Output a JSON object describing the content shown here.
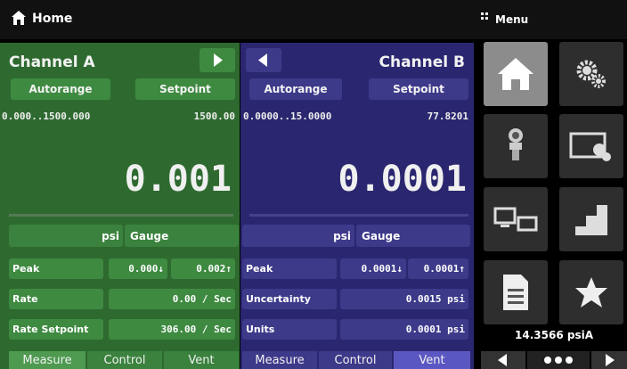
{
  "header": {
    "title": "Home",
    "menu_title": "Menu"
  },
  "colors": {
    "channel_a": "#2e6a30",
    "channel_b": "#2a2770",
    "button_a": "#3e8a41",
    "button_b": "#3d3a8a",
    "tab_active_b": "#5b57c2"
  },
  "channel_a": {
    "title": "Channel A",
    "autorange": "Autorange",
    "setpoint": "Setpoint",
    "range": "0.000..1500.000",
    "range_max": "1500.00",
    "reading": "0.001",
    "unit": "psi",
    "mode": "Gauge",
    "rows": [
      {
        "label": "Peak",
        "value_low": "0.000↓",
        "value_high": "0.002↑"
      },
      {
        "label": "Rate",
        "value": "0.00 / Sec"
      },
      {
        "label": "Rate Setpoint",
        "value": "306.00 / Sec"
      }
    ],
    "tabs": [
      "Measure",
      "Control",
      "Vent"
    ]
  },
  "channel_b": {
    "title": "Channel B",
    "autorange": "Autorange",
    "setpoint": "Setpoint",
    "range": "0.0000..15.0000",
    "range_max": "77.8201",
    "reading": "0.0001",
    "unit": "psi",
    "mode": "Gauge",
    "rows": [
      {
        "label": "Peak",
        "value_low": "0.0001↓",
        "value_high": "0.0001↑"
      },
      {
        "label": "Uncertainty",
        "value": "0.0015 psi"
      },
      {
        "label": "Units",
        "value": "0.0001 psi"
      }
    ],
    "tabs": [
      "Measure",
      "Control",
      "Vent"
    ]
  },
  "menu": {
    "tiles": [
      "home-icon",
      "settings-icon",
      "sensor-icon",
      "display-settings-icon",
      "remote-icon",
      "steps-icon",
      "document-icon",
      "favorites-icon"
    ],
    "barometer": "14.3566 psiA"
  }
}
